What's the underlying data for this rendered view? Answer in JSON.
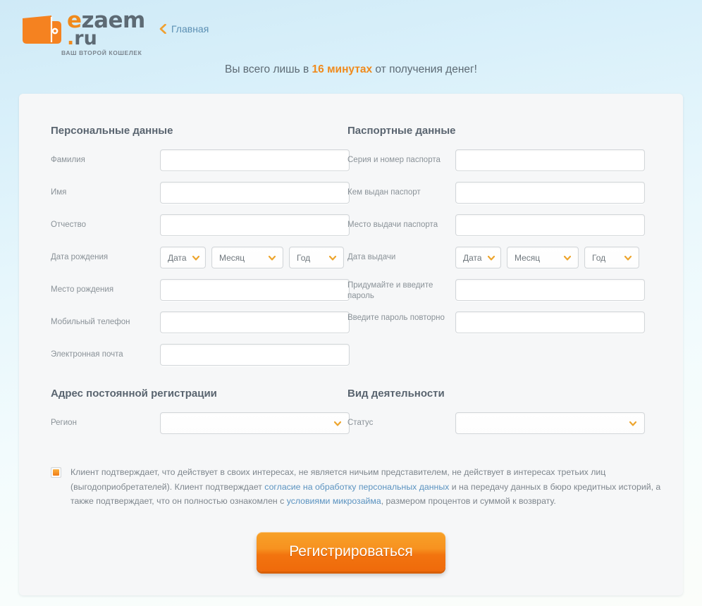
{
  "header": {
    "logo": {
      "brand_prefix": "e",
      "brand_main": "zaem",
      "tld_dot": ".",
      "tld": "ru",
      "slogan": "ВАШ ВТОРОЙ КОШЕЛЕК",
      "icon": "wallet-icon"
    },
    "home_link": {
      "label": "Главная",
      "icon": "chevron-left-icon"
    },
    "tagline": {
      "before": "Вы всего лишь в ",
      "highlight": "16 минутах",
      "after": " от получения денег!"
    }
  },
  "sections": {
    "personal": {
      "title": "Персональные данные",
      "fields": [
        {
          "label": "Фамилия",
          "type": "text",
          "value": "",
          "placeholder": ""
        },
        {
          "label": "Имя",
          "type": "text",
          "value": "",
          "placeholder": ""
        },
        {
          "label": "Отчество",
          "type": "text",
          "value": "",
          "placeholder": ""
        },
        {
          "label": "Дата рождения",
          "type": "date-group"
        },
        {
          "label": "Место рождения",
          "type": "text",
          "value": "",
          "placeholder": ""
        },
        {
          "label": "Мобильный телефон",
          "type": "text",
          "value": "",
          "placeholder": ""
        },
        {
          "label": "Электронная почта",
          "type": "text",
          "value": "",
          "placeholder": ""
        }
      ]
    },
    "passport": {
      "title": "Паспортные данные",
      "fields": [
        {
          "label": "Серия и номер паспорта",
          "type": "text",
          "value": "",
          "placeholder": ""
        },
        {
          "label": "Кем выдан паспорт",
          "type": "text",
          "value": "",
          "placeholder": ""
        },
        {
          "label": "Место выдачи паспорта",
          "type": "text",
          "value": "",
          "placeholder": ""
        },
        {
          "label": "Дата выдачи",
          "type": "date-group"
        },
        {
          "label": "Придумайте и введите пароль",
          "type": "password",
          "value": "",
          "placeholder": ""
        },
        {
          "label": "Введите пароль повторно",
          "type": "password",
          "value": "",
          "placeholder": ""
        }
      ]
    },
    "address": {
      "title": "Адрес постоянной регистрации",
      "region_label": "Регион",
      "region_value": ""
    },
    "activity": {
      "title": "Вид деятельности",
      "status_label": "Статус",
      "status_value": ""
    }
  },
  "date_selects": {
    "day": "Дата",
    "month": "Месяц",
    "year": "Год"
  },
  "consent": {
    "checked": true,
    "part1": "Клиент подтверждает, что действует в своих интересах, не является ничьим представителем, не действует в интересах третьих лиц (выгодоприобретателей). Клиент подтверждает ",
    "link1": "согласие на обработку персональных данных",
    "part2": " и на передачу данных в бюро кредитных историй, а также подтверждает, что он полностью ознакомлен с ",
    "link2": "условиями микрозайма",
    "part3": ", размером процентов и суммой к возврату."
  },
  "submit": {
    "label": "Регистрироваться"
  },
  "colors": {
    "accent_orange": "#f08a1c",
    "button_orange_top": "#f7a128",
    "button_orange_bottom": "#ef6a0b",
    "link_blue": "#5b93c0",
    "heading_gray": "#5a6570",
    "label_gray": "#8a9298",
    "panel_bg": "#f6f7f8",
    "page_bg_top": "#cfeaf7"
  }
}
